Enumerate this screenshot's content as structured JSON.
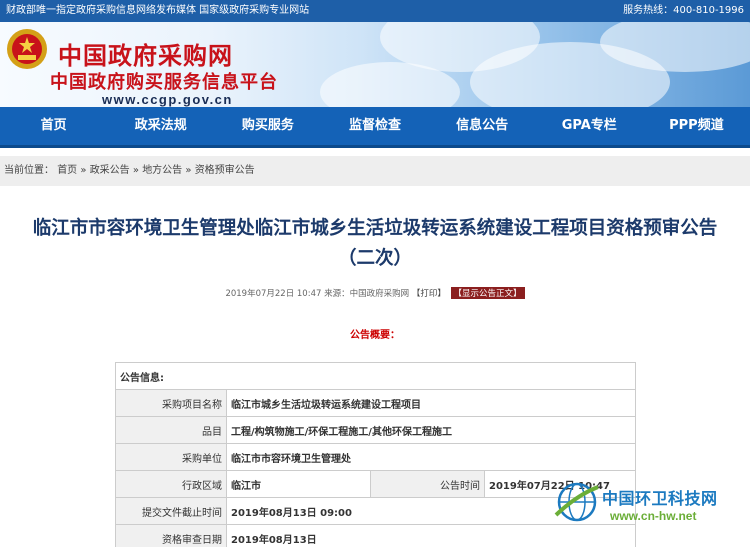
{
  "topbar": {
    "left_text": "财政部唯一指定政府采购信息网络发布媒体 国家级政府采购专业网站",
    "hotline": "服务热线：400-810-1996"
  },
  "banner": {
    "logo_title": "中国政府采购网",
    "logo_subtitle": "中国政府购买服务信息平台",
    "logo_url": "www.ccgp.gov.cn"
  },
  "nav": {
    "items": [
      "首页",
      "政采法规",
      "购买服务",
      "监督检查",
      "信息公告",
      "GPA专栏",
      "PPP频道"
    ]
  },
  "breadcrumb": {
    "prefix": "当前位置：",
    "items": [
      "首页",
      "政采公告",
      "地方公告",
      "资格预审公告"
    ],
    "separator": "»"
  },
  "article": {
    "title": "临江市市容环境卫生管理处临江市城乡生活垃圾转运系统建设工程项目资格预审公告（二次）",
    "meta": "2019年07月22日 10:47 来源：中国政府采购网",
    "print_label": "【打印】",
    "show_body_label": "【显示公告正文】",
    "summary_title": "公告概要："
  },
  "info_table": {
    "heading": "公告信息:",
    "rows": [
      {
        "label": "采购项目名称",
        "value": "临江市城乡生活垃圾转运系统建设工程项目"
      },
      {
        "label": "品目",
        "value": "工程/构筑物施工/环保工程施工/其他环保工程施工"
      },
      {
        "label": "采购单位",
        "value": "临江市市容环境卫生管理处"
      },
      {
        "label": "行政区域",
        "value": "临江市",
        "label2": "公告时间",
        "value2": "2019年07月22日 10:47"
      },
      {
        "label": "提交文件截止时间",
        "value": "2019年08月13日 09:00"
      },
      {
        "label": "资格审查日期",
        "value": "2019年08月13日"
      }
    ]
  },
  "watermark": {
    "text": "中国环卫科技网",
    "url": "www.cn-hw.net"
  },
  "colors": {
    "topbar": "#1e5fa8",
    "nav": "#1462b7",
    "logo_red": "#c8121a",
    "title_blue": "#1c3a6b"
  }
}
